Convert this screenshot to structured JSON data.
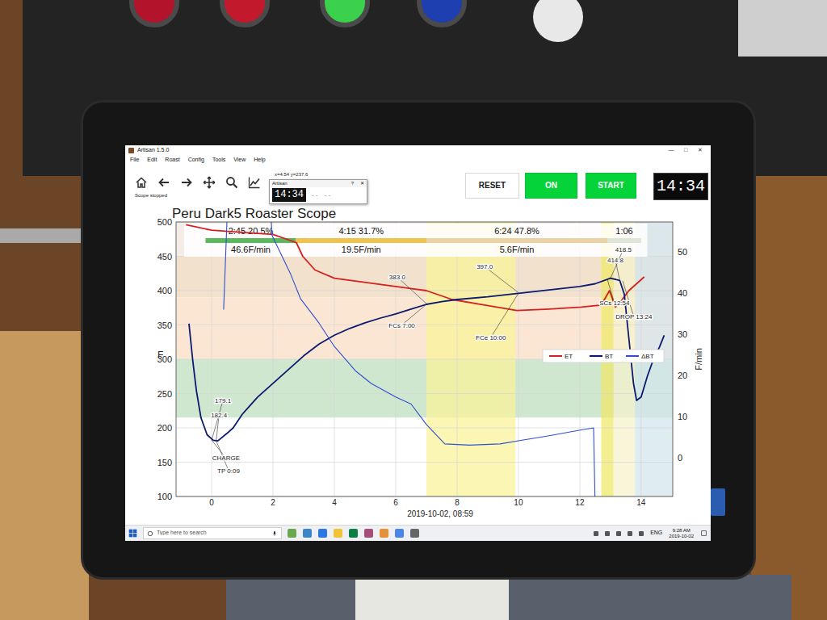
{
  "window": {
    "title": "Artisan 1.5.0",
    "controls": [
      "—",
      "□",
      "✕"
    ]
  },
  "menu": [
    "File",
    "Edit",
    "Roast",
    "Config",
    "Tools",
    "View",
    "Help"
  ],
  "toolbar": {
    "status": "Scope stopped",
    "cursor": "x=4:54 y=237.6",
    "buttons": [
      {
        "label": "RESET",
        "kind": "plain"
      },
      {
        "label": "ON",
        "kind": "green"
      },
      {
        "label": "START",
        "kind": "green"
      }
    ],
    "timer": "14:34"
  },
  "popup": {
    "title": "Artisan",
    "controls": [
      "?",
      "✕"
    ],
    "timer": "14:34",
    "extra": [
      "--",
      "--"
    ]
  },
  "chart": {
    "title": "Peru Dark5 Roaster Scope",
    "y_label": "F",
    "y2_label": "F/min",
    "y_ticks": [
      "100",
      "150",
      "200",
      "250",
      "300",
      "350",
      "400",
      "450",
      "500"
    ],
    "y2_ticks": [
      "0",
      "10",
      "20",
      "30",
      "40",
      "50"
    ],
    "x_ticks": [
      "0",
      "2",
      "4",
      "6",
      "8",
      "10",
      "12",
      "14"
    ],
    "date": "2019-10-02, 08:59",
    "horizontal_bands": [
      {
        "from": 450,
        "to": 500,
        "color": "#f4ece6"
      },
      {
        "from": 390,
        "to": 450,
        "color": "#f2e1cc"
      },
      {
        "from": 300,
        "to": 390,
        "color": "#fbe6d3"
      },
      {
        "from": 215,
        "to": 300,
        "color": "#cfe7cf"
      }
    ],
    "vertical_bands": [
      {
        "from": 7,
        "to": 9.9,
        "color": "#faf39a"
      },
      {
        "from": 12.7,
        "to": 13.1,
        "color": "#efe86a"
      },
      {
        "from": 13.1,
        "to": 13.8,
        "color": "#f5f2cc"
      },
      {
        "from": 13.8,
        "to": 15.1,
        "color": "#d4e6ee"
      }
    ],
    "phases": [
      {
        "label": "2:45 20.5%",
        "rate": "46.6F/min",
        "from": -0.2,
        "to": 2.75,
        "color": "#5cb85c"
      },
      {
        "label": "4:15 31.7%",
        "rate": "19.5F/min",
        "from": 2.75,
        "to": 7,
        "color": "#f0c24e"
      },
      {
        "label": "6:24 47.8%",
        "rate": "5.6F/min",
        "from": 7,
        "to": 12.9,
        "color": "#ead2a4"
      },
      {
        "label": "1:06",
        "from": 12.9,
        "to": 14.0,
        "color": "#dfe6d8"
      }
    ],
    "series": [
      {
        "name": "ET",
        "axis": "temp",
        "color": "#d62020",
        "t": [
          -0.84,
          0,
          1,
          2,
          2.76,
          2.97,
          3.37,
          4,
          4.68,
          6,
          7,
          7.84,
          8.9,
          9.95,
          11,
          12.05,
          12.7,
          12.97,
          13.16,
          13.3,
          13.6,
          14.1
        ],
        "values": [
          496,
          488,
          485,
          482,
          470,
          450,
          430,
          418,
          414,
          406,
          400,
          387,
          379,
          371,
          373,
          376,
          379,
          400,
          376,
          382,
          400,
          420
        ]
      },
      {
        "name": "BT",
        "axis": "temp",
        "color": "#0b1a6e",
        "t": [
          -0.74,
          -0.62,
          -0.5,
          -0.35,
          -0.15,
          0.05,
          0.2,
          0.5,
          0.7,
          1,
          1.5,
          2,
          2.5,
          3,
          3.5,
          4,
          4.5,
          5,
          5.5,
          6,
          6.5,
          7,
          7.5,
          8,
          9,
          10,
          11,
          12,
          12.5,
          13,
          13.3,
          13.45,
          13.6,
          13.75,
          13.85,
          14,
          14.2,
          14.4,
          14.6,
          14.75
        ],
        "values": [
          352,
          300,
          255,
          215,
          190,
          182,
          181,
          192,
          200,
          220,
          245,
          265,
          285,
          305,
          322,
          335,
          345,
          353,
          360,
          366,
          373,
          380,
          384,
          387,
          391,
          396,
          401,
          406,
          410,
          418,
          415,
          395,
          330,
          265,
          240,
          245,
          275,
          300,
          318,
          335
        ]
      },
      {
        "name": "ΔBT",
        "axis": "rate",
        "color": "#2f4fd0",
        "t": [
          0.39,
          0.5,
          0.6,
          1.8,
          1.97,
          2.58,
          2.9,
          3.5,
          4,
          4.7,
          5.2,
          6,
          6.5,
          7,
          7.6,
          8.4,
          9.4,
          10.2,
          11,
          12.05,
          12.45,
          12.5
        ],
        "values": [
          36,
          58,
          75,
          75,
          54,
          44.5,
          38.6,
          32.7,
          27,
          21,
          18,
          14.7,
          13,
          8,
          3.3,
          3,
          3.3,
          4.3,
          5.3,
          6.7,
          7.2,
          -12
        ]
      }
    ],
    "annotations": [
      {
        "text": "179.1",
        "t": 0.37,
        "v": 240,
        "at_t": 0.0,
        "at_v": 182
      },
      {
        "text": "182.4",
        "t": 0.24,
        "v": 219,
        "at_t": 0.15,
        "at_v": 182
      },
      {
        "text": "CHARGE",
        "t": 0.47,
        "v": 156,
        "at_t": 0.0,
        "at_v": 182
      },
      {
        "text": "TP 0:09",
        "t": 0.55,
        "v": 138,
        "at_t": 0.15,
        "at_v": 181
      },
      {
        "text": "383.0",
        "t": 6.05,
        "v": 420,
        "at_t": 7.0,
        "at_v": 381
      },
      {
        "text": "FCs 7:00",
        "t": 6.2,
        "v": 350,
        "at_t": 7.0,
        "at_v": 380
      },
      {
        "text": "397.0",
        "t": 8.9,
        "v": 435,
        "at_t": 10.0,
        "at_v": 397
      },
      {
        "text": "FCe 10:00",
        "t": 9.1,
        "v": 332,
        "at_t": 10.0,
        "at_v": 396
      },
      {
        "text": "418.5",
        "t": 13.42,
        "v": 460,
        "at_t": 13.0,
        "at_v": 418
      },
      {
        "text": "414.8",
        "t": 13.16,
        "v": 445,
        "at_t": 13.3,
        "at_v": 415
      },
      {
        "text": "SCs 12:54",
        "t": 13.13,
        "v": 382,
        "at_t": 12.9,
        "at_v": 416
      },
      {
        "text": "DROP 13:24",
        "t": 13.76,
        "v": 362,
        "at_t": 13.4,
        "at_v": 414
      }
    ]
  },
  "taskbar": {
    "search": {
      "placeholder": "Type here to search"
    },
    "language": "ENG",
    "time": "9:28 AM",
    "date": "2019-10-02"
  }
}
